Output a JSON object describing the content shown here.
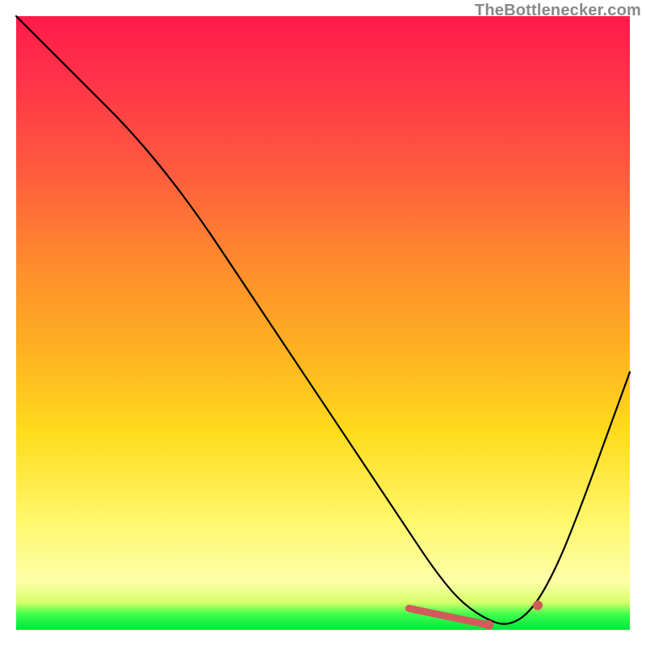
{
  "attribution": "TheBottlenecker.com",
  "chart_data": {
    "type": "line",
    "title": "",
    "xlabel": "",
    "ylabel": "",
    "xlim": [
      0,
      100
    ],
    "ylim": [
      0,
      100
    ],
    "x": [
      0,
      6,
      12,
      18,
      24,
      30,
      36,
      42,
      48,
      54,
      60,
      64,
      68,
      72,
      76,
      80,
      84,
      88,
      92,
      96,
      100
    ],
    "values": [
      100,
      94,
      88,
      82,
      75,
      67,
      58,
      49,
      40,
      31,
      22,
      16,
      10,
      5,
      2,
      0.5,
      3,
      10,
      20,
      31,
      42
    ],
    "markers": {
      "segment_x": [
        64,
        77
      ],
      "segment_y": [
        3.5,
        0.8
      ],
      "loose_dot_x": 85,
      "loose_dot_y": 4
    },
    "gradient_colors": {
      "top": "#ff1a4b",
      "mid_upper": "#ff8a2e",
      "mid": "#ffdc1d",
      "lower": "#feffa8",
      "bottom": "#00e53d"
    }
  }
}
